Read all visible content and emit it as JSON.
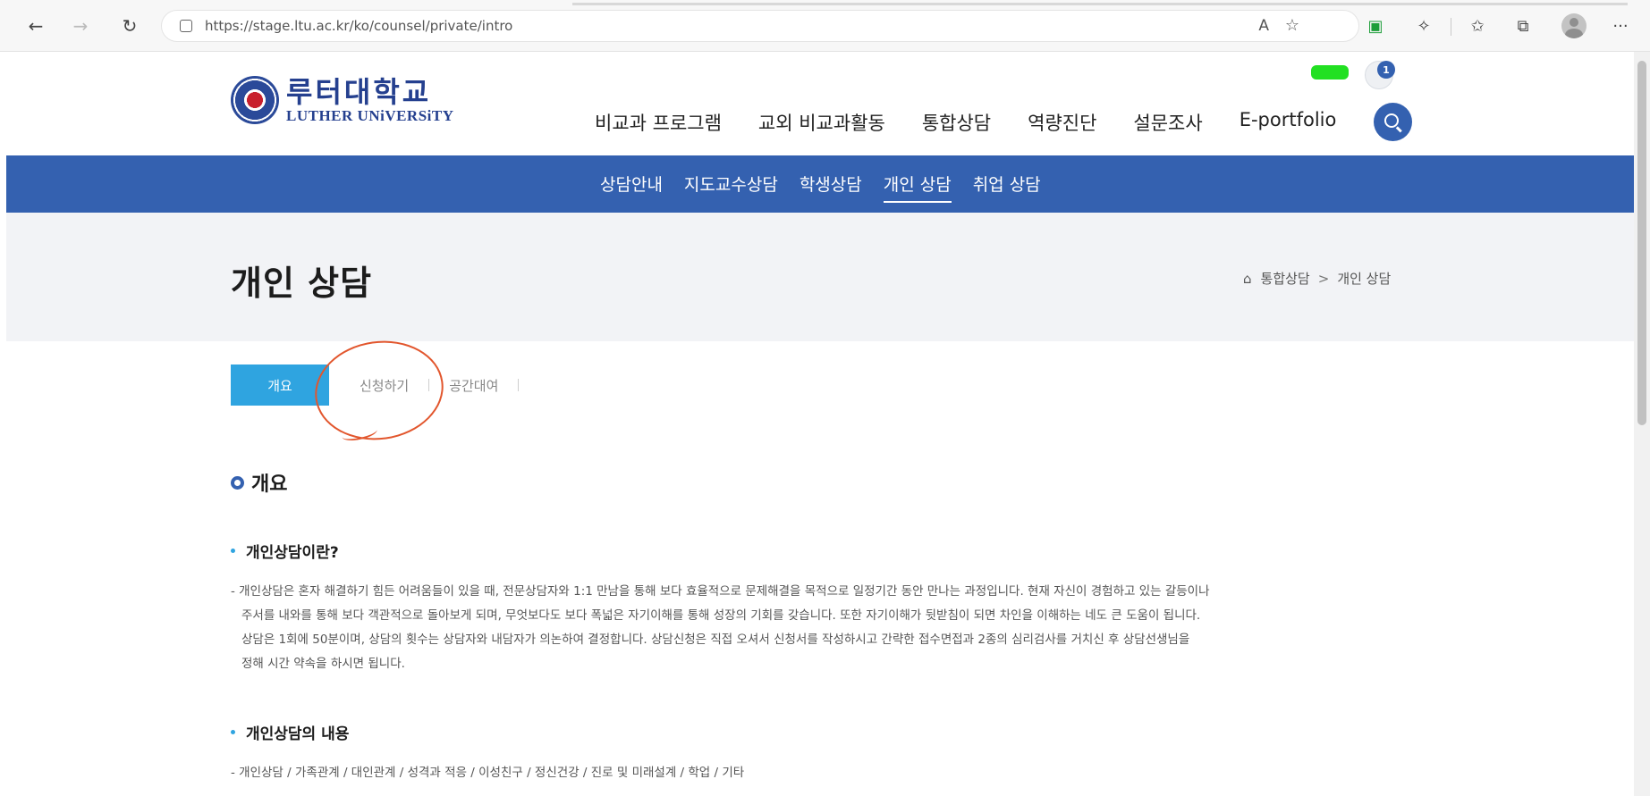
{
  "browser": {
    "url": "https://stage.ltu.ac.kr/ko/counsel/private/intro",
    "icons": [
      "back-arrow-icon",
      "forward-arrow-icon",
      "refresh-icon",
      "lock-icon",
      "read-aloud-icon",
      "add-favorite-icon",
      "extension-icon",
      "puzzle-icon",
      "favorites-icon",
      "collections-icon",
      "profile-icon",
      "more-icon"
    ],
    "back_glyph": "←",
    "forward_glyph": "→",
    "refresh_glyph": "↻",
    "read_glyph": "A",
    "fav_glyph": "☆",
    "ext_glyph": "▣",
    "ext2_glyph": "✧",
    "favorites_glyph": "✩",
    "collections_glyph": "⧉",
    "more_glyph": "···"
  },
  "site": {
    "logo_ko": "루터대학교",
    "logo_en": "LUTHER UNiVERSiTY",
    "notification_count": "1",
    "accent_color": "#3461b0"
  },
  "gnb": {
    "items": [
      "비교과 프로그램",
      "교외 비교과활동",
      "통합상담",
      "역량진단",
      "설문조사",
      "E-portfolio"
    ]
  },
  "subnav": {
    "items": [
      "상담안내",
      "지도교수상담",
      "학생상담",
      "개인 상담",
      "취업 상담"
    ],
    "active_index": 3
  },
  "page": {
    "title": "개인 상담",
    "breadcrumb": [
      "통합상담",
      "개인 상담"
    ],
    "breadcrumb_sep": ">",
    "home_glyph": "⌂"
  },
  "tabs": {
    "items": [
      "개요",
      "신청하기",
      "공간대여"
    ],
    "active_index": 0
  },
  "content": {
    "section_title": "개요",
    "sub1_title": "개인상담이란?",
    "sub1_lines": [
      "- 개인상담은 혼자 해결하기 힘든 어려움들이 있을 때, 전문상담자와 1:1 만남을 통해 보다 효율적으로 문제해결을 목적으로 일정기간 동안 만나는 과정입니다. 현재 자신이 경험하고 있는 갈등이나",
      "주서를 내와를 통해 보다 객관적으로 돌아보게 되며, 무엇보다도 보다 폭넓은 자기이해를 통해 성장의 기회를 갖습니다. 또한 자기이해가 뒷받침이 되면 차인을 이해하는 네도 큰 도움이 됩니다.",
      "상담은 1회에 50분이며, 상담의 횟수는 상담자와 내담자가 의논하여 결정합니다. 상담신청은 직접 오셔서 신청서를 작성하시고 간략한 접수면접과 2종의 심리검사를 거치신 후 상담선생님을",
      "정해 시간 약속을 하시면 됩니다."
    ],
    "sub2_title": "개인상담의 내용",
    "sub2_line": "- 개인상담 / 가족관계 / 대인관계 / 성격과 적응 / 이성친구 / 정신건강 / 진로 및 미래설계 / 학업 / 기타"
  }
}
